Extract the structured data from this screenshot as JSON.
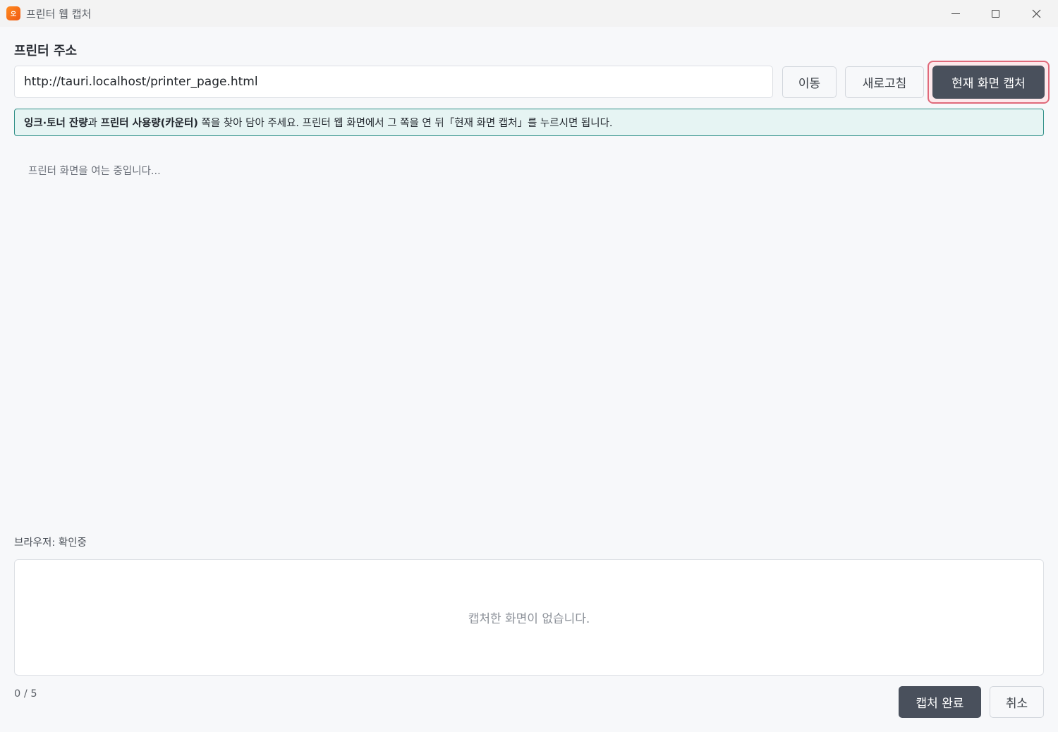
{
  "window": {
    "title": "프린터 웹 캡처",
    "icon_text": "오"
  },
  "address": {
    "label": "프린터 주소",
    "url_value": "http://tauri.localhost/printer_page.html"
  },
  "toolbar": {
    "go_label": "이동",
    "reload_label": "새로고침",
    "capture_label": "현재 화면 캡처"
  },
  "banner": {
    "bold_1": "잉크·토너 잔량",
    "text_1": "과 ",
    "bold_2": "프린터 사용량(카운터)",
    "text_2": " 쪽을 찾아 담아 주세요. 프린터 웹 화면에서 그 쪽을 연 뒤「현재 화면 캡처」를 누르시면 됩니다."
  },
  "main": {
    "loading_text": "프린터 화면을 여는 중입니다..."
  },
  "status": {
    "browser_text": "브라우저: 확인중"
  },
  "captures": {
    "empty_text": "캡처한 화면이 없습니다.",
    "counter": "0 / 5"
  },
  "footer": {
    "done_label": "캡처 완료",
    "cancel_label": "취소"
  },
  "colors": {
    "primary_button": "#49505c",
    "banner_border": "#2f8f87",
    "banner_bg": "#e6f4f3",
    "highlight_ring": "#e0697a",
    "app_icon": "#f05a14"
  }
}
